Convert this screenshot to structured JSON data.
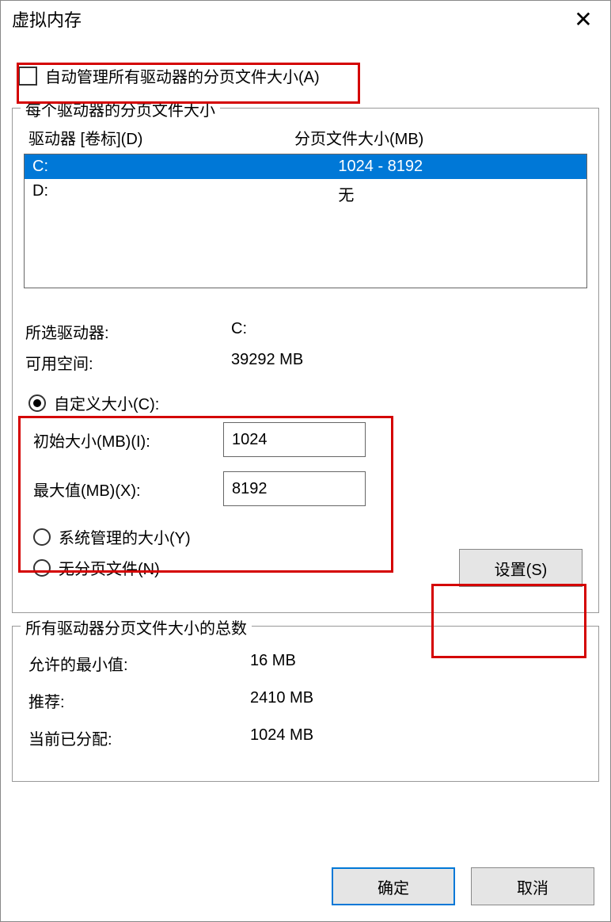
{
  "title": "虚拟内存",
  "auto_manage_label": "自动管理所有驱动器的分页文件大小(A)",
  "group1": {
    "legend": "每个驱动器的分页文件大小",
    "col_drive": "驱动器 [卷标](D)",
    "col_size": "分页文件大小(MB)",
    "rows": [
      {
        "drive": "C:",
        "size": "1024 - 8192",
        "selected": true
      },
      {
        "drive": "D:",
        "size": "无",
        "selected": false
      }
    ],
    "selected_drive_label": "所选驱动器:",
    "selected_drive_value": "C:",
    "free_space_label": "可用空间:",
    "free_space_value": "39292 MB",
    "radio_custom": "自定义大小(C):",
    "initial_label": "初始大小(MB)(I):",
    "initial_value": "1024",
    "max_label": "最大值(MB)(X):",
    "max_value": "8192",
    "radio_system": "系统管理的大小(Y)",
    "radio_none": "无分页文件(N)",
    "set_button": "设置(S)"
  },
  "group2": {
    "legend": "所有驱动器分页文件大小的总数",
    "min_label": "允许的最小值:",
    "min_value": "16 MB",
    "rec_label": "推荐:",
    "rec_value": "2410 MB",
    "cur_label": "当前已分配:",
    "cur_value": "1024 MB"
  },
  "buttons": {
    "ok": "确定",
    "cancel": "取消"
  }
}
